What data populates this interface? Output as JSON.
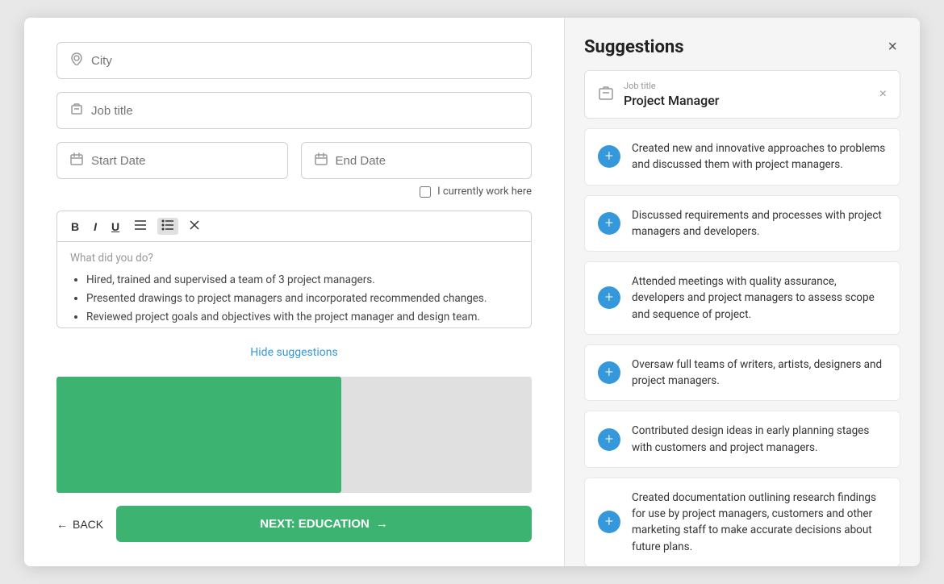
{
  "left": {
    "city_placeholder": "City",
    "job_title_placeholder": "Job title",
    "start_date_placeholder": "Start Date",
    "end_date_placeholder": "End Date",
    "currently_work_label": "I currently work here",
    "editor_placeholder": "What did you do?",
    "editor_bullets": [
      "Hired, trained and supervised a team of 3 project managers.",
      "Presented drawings to project managers and incorporated recommended changes.",
      "Reviewed project goals and objectives with the project manager and design team."
    ],
    "hide_suggestions_label": "Hide suggestions",
    "back_label": "BACK",
    "next_label": "NEXT: EDUCATION"
  },
  "right": {
    "title": "Suggestions",
    "close_icon": "×",
    "job_title_label": "Job title",
    "job_title_value": "Project Manager",
    "suggestions": [
      "Created new and innovative approaches to problems and discussed them with project managers.",
      "Discussed requirements and processes with project managers and developers.",
      "Attended meetings with quality assurance, developers and project managers to assess scope and sequence of project.",
      "Oversaw full teams of writers, artists, designers and project managers.",
      "Contributed design ideas in early planning stages with customers and project managers.",
      "Created documentation outlining research findings for use by project managers, customers and other marketing staff to make accurate decisions about future plans."
    ]
  },
  "toolbar": {
    "bold": "B",
    "italic": "I",
    "underline": "U",
    "align": "≡",
    "list": "☰",
    "clear": "✕"
  },
  "icons": {
    "city": "⊙",
    "job": "▣",
    "calendar": "▦",
    "person": "▣"
  }
}
